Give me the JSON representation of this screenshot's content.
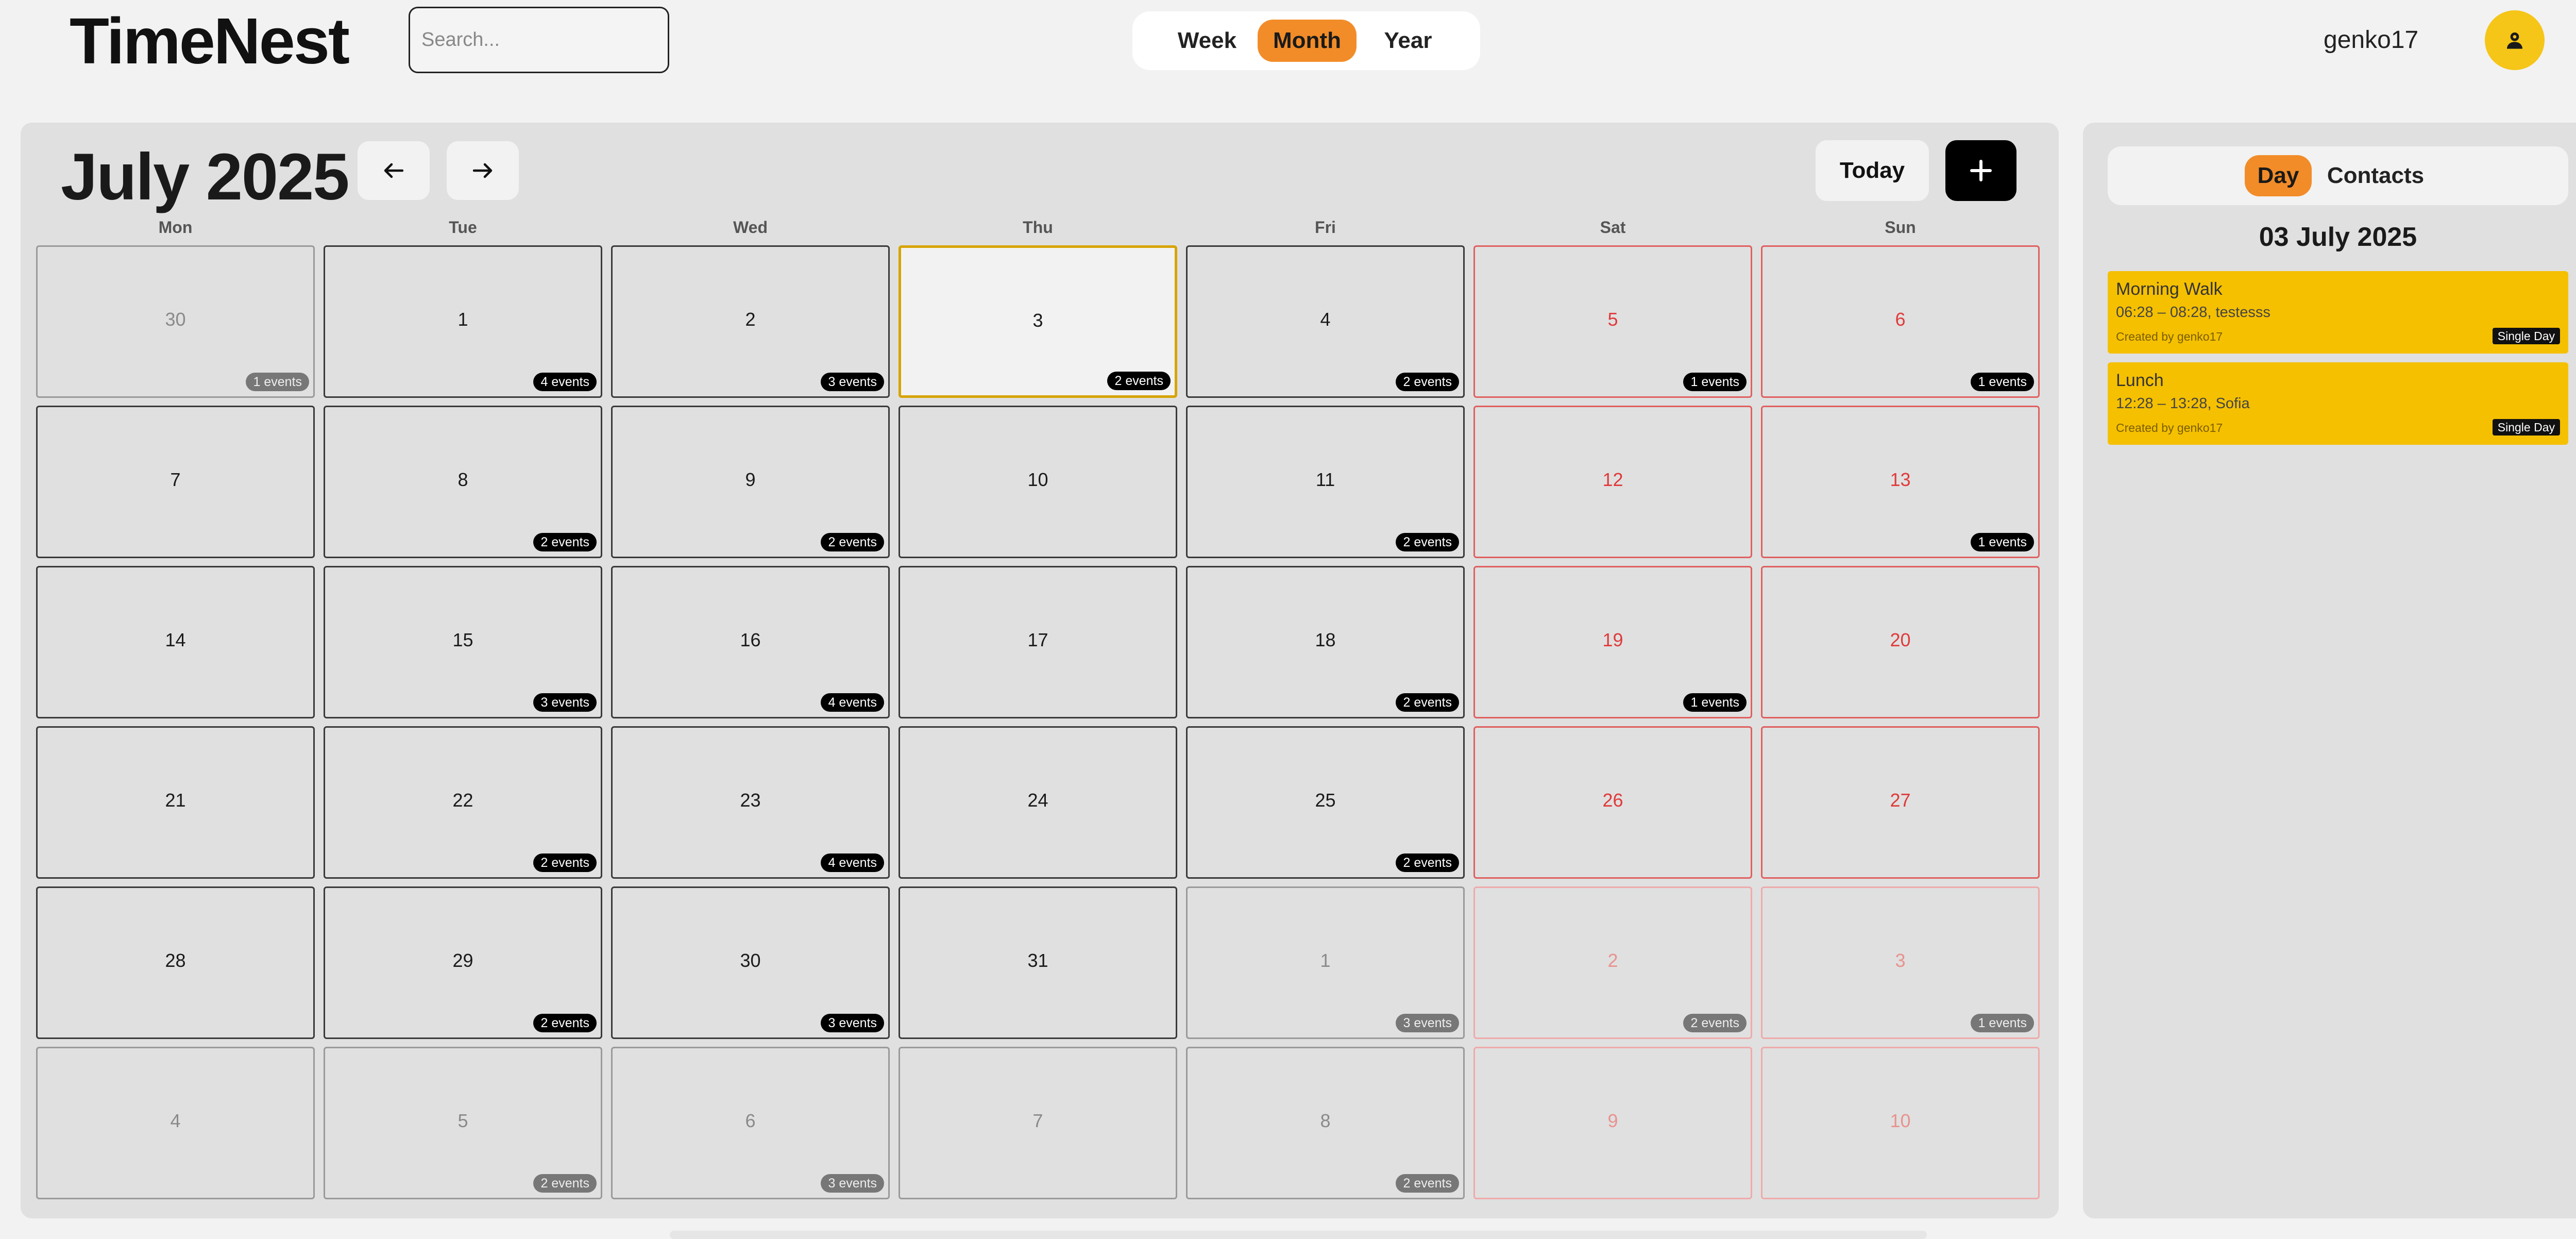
{
  "app": {
    "logo": "TimeNest"
  },
  "search": {
    "placeholder": "Search..."
  },
  "views": [
    "Week",
    "Month",
    "Year"
  ],
  "active_view": "Month",
  "user": {
    "name": "genko17"
  },
  "calendar": {
    "title": "July 2025",
    "today_label": "Today",
    "weekdays": [
      "Mon",
      "Tue",
      "Wed",
      "Thu",
      "Fri",
      "Sat",
      "Sun"
    ],
    "weeks": [
      [
        {
          "d": "30",
          "e": "1 events",
          "o": true
        },
        {
          "d": "1",
          "e": "4 events"
        },
        {
          "d": "2",
          "e": "3 events"
        },
        {
          "d": "3",
          "e": "2 events",
          "t": true
        },
        {
          "d": "4",
          "e": "2 events"
        },
        {
          "d": "5",
          "e": "1 events"
        },
        {
          "d": "6",
          "e": "1 events"
        }
      ],
      [
        {
          "d": "7"
        },
        {
          "d": "8",
          "e": "2 events"
        },
        {
          "d": "9",
          "e": "2 events"
        },
        {
          "d": "10"
        },
        {
          "d": "11",
          "e": "2 events"
        },
        {
          "d": "12"
        },
        {
          "d": "13",
          "e": "1 events"
        }
      ],
      [
        {
          "d": "14"
        },
        {
          "d": "15",
          "e": "3 events"
        },
        {
          "d": "16",
          "e": "4 events"
        },
        {
          "d": "17"
        },
        {
          "d": "18",
          "e": "2 events"
        },
        {
          "d": "19",
          "e": "1 events"
        },
        {
          "d": "20"
        }
      ],
      [
        {
          "d": "21"
        },
        {
          "d": "22",
          "e": "2 events"
        },
        {
          "d": "23",
          "e": "4 events"
        },
        {
          "d": "24"
        },
        {
          "d": "25",
          "e": "2 events"
        },
        {
          "d": "26"
        },
        {
          "d": "27"
        }
      ],
      [
        {
          "d": "28"
        },
        {
          "d": "29",
          "e": "2 events"
        },
        {
          "d": "30",
          "e": "3 events"
        },
        {
          "d": "31"
        },
        {
          "d": "1",
          "e": "3 events",
          "o": true
        },
        {
          "d": "2",
          "e": "2 events",
          "o": true
        },
        {
          "d": "3",
          "e": "1 events",
          "o": true
        }
      ],
      [
        {
          "d": "4",
          "o": true
        },
        {
          "d": "5",
          "e": "2 events",
          "o": true
        },
        {
          "d": "6",
          "e": "3 events",
          "o": true
        },
        {
          "d": "7",
          "o": true
        },
        {
          "d": "8",
          "e": "2 events",
          "o": true
        },
        {
          "d": "9",
          "o": true
        },
        {
          "d": "10",
          "o": true
        }
      ]
    ]
  },
  "side": {
    "tabs": [
      "Day",
      "Contacts"
    ],
    "active_tab": "Day",
    "date": "03 July 2025",
    "events": [
      {
        "title": "Morning Walk",
        "time": "06:28 – 08:28, testesss",
        "created": "Created by genko17",
        "type": "Single Day"
      },
      {
        "title": "Lunch",
        "time": "12:28 – 13:28, Sofia",
        "created": "Created by genko17",
        "type": "Single Day"
      }
    ]
  },
  "colors": {
    "accent": "#f28c28",
    "event": "#f5c000",
    "weekend": "#e03a3a",
    "today_border": "#d6a400"
  },
  "icons": {
    "prev": "arrow-left-icon",
    "next": "arrow-right-icon",
    "add": "plus-icon",
    "avatar": "user-icon"
  }
}
